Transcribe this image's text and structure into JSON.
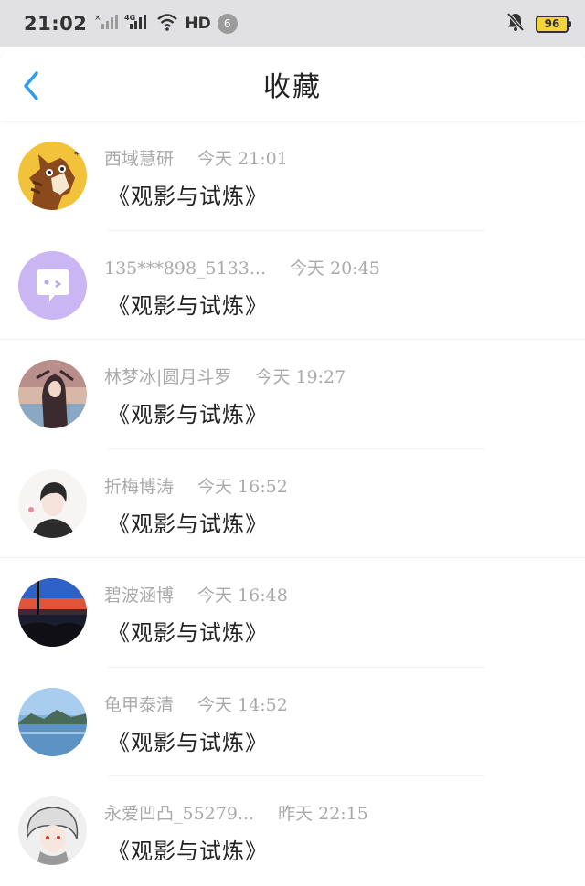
{
  "status_bar": {
    "time": "21:02",
    "network_label": "HD",
    "notification_count": "6",
    "battery": "96"
  },
  "header": {
    "title": "收藏",
    "back_icon": "chevron-left-icon"
  },
  "favorites": [
    {
      "user": "西域慧研",
      "time": "今天 21:01",
      "content": "《观影与试炼》",
      "avatar": "cartoon-horse"
    },
    {
      "user": "135***898_5133...",
      "time": "今天 20:45",
      "content": "《观影与试炼》",
      "avatar": "chat-bubble"
    },
    {
      "user": "林梦冰|圆月斗罗",
      "time": "今天 19:27",
      "content": "《观影与试炼》",
      "avatar": "anime-girl"
    },
    {
      "user": "折梅博涛",
      "time": "今天 16:52",
      "content": "《观影与试炼》",
      "avatar": "anime-boy"
    },
    {
      "user": "碧波涵博",
      "time": "今天 16:48",
      "content": "《观影与试炼》",
      "avatar": "sunset-window"
    },
    {
      "user": "龟甲泰清",
      "time": "今天 14:52",
      "content": "《观影与试炼》",
      "avatar": "lake-landscape"
    },
    {
      "user": "永爱凹凸_55279...",
      "time": "昨天 22:15",
      "content": "《观影与试炼》",
      "avatar": "anime-white-hair"
    }
  ],
  "colors": {
    "status_bar_bg": "#e1e1e3",
    "accent_blue": "#2d9cf0",
    "meta_gray": "#aaaaaa",
    "battery_yellow": "#f5d33a"
  }
}
